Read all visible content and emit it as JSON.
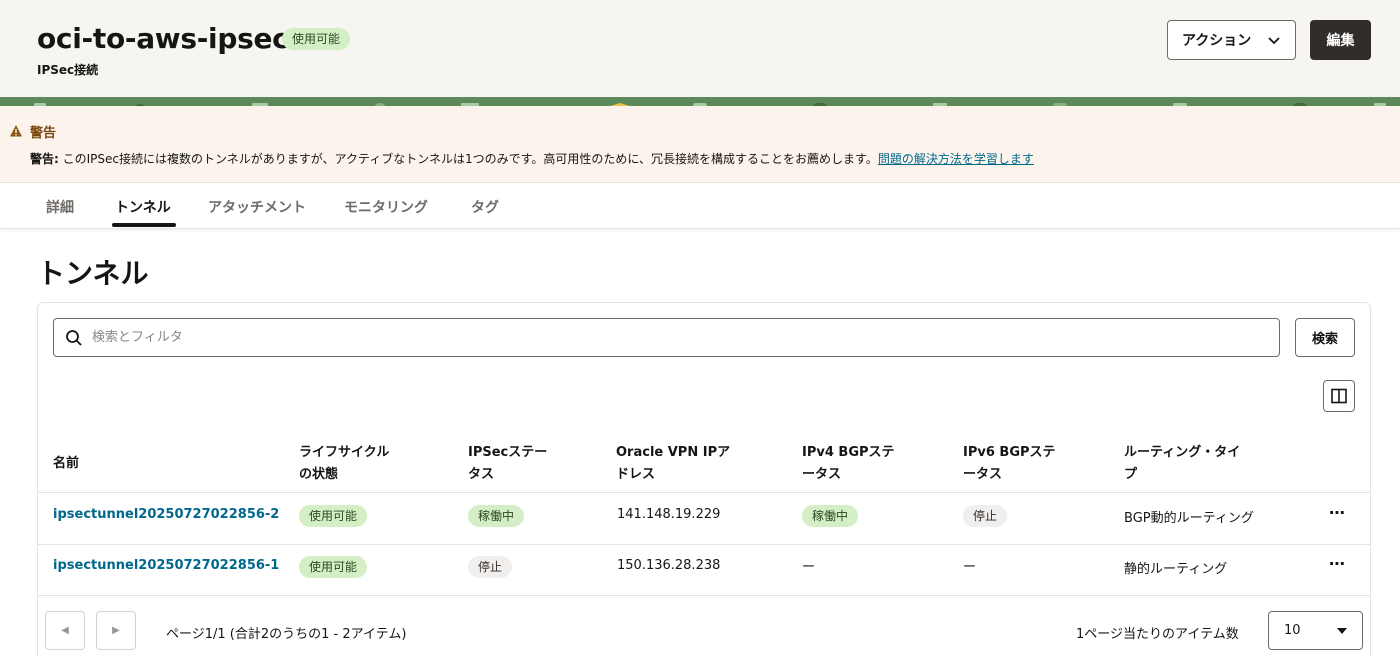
{
  "header": {
    "title": "oci-to-aws-ipsec",
    "status_badge": "使用可能",
    "subtitle": "IPSec接続",
    "action_label": "アクション",
    "edit_label": "編集"
  },
  "warning": {
    "title": "警告",
    "prefix": "警告:",
    "message": " このIPSec接続には複数のトンネルがありますが、アクティブなトンネルは1つのみです。高可用性のために、冗長接続を構成することをお薦めします。",
    "link": "問題の解決方法を学習します"
  },
  "tabs": [
    {
      "label": "詳細"
    },
    {
      "label": "トンネル",
      "active": true
    },
    {
      "label": "アタッチメント"
    },
    {
      "label": "モニタリング"
    },
    {
      "label": "タグ"
    }
  ],
  "section": {
    "title": "トンネル"
  },
  "search": {
    "placeholder": "検索とフィルタ",
    "button": "検索"
  },
  "table": {
    "headers": [
      {
        "line1": "名前",
        "line2": ""
      },
      {
        "line1": "ライフサイクル",
        "line2": "の状態"
      },
      {
        "line1": "IPSecステー",
        "line2": "タス"
      },
      {
        "line1": "Oracle VPN IPア",
        "line2": "ドレス"
      },
      {
        "line1": "IPv4 BGPステ",
        "line2": "ータス"
      },
      {
        "line1": "IPv6 BGPステ",
        "line2": "ータス"
      },
      {
        "line1": "ルーティング・タイ",
        "line2": "プ"
      }
    ],
    "rows": [
      {
        "name": "ipsectunnel20250727022856-2",
        "lifecycle": "使用可能",
        "ipsec_status": "稼働中",
        "vpn_ip": "141.148.19.229",
        "ipv4_bgp": "稼働中",
        "ipv6_bgp": "停止",
        "routing": "BGP動的ルーティング"
      },
      {
        "name": "ipsectunnel20250727022856-1",
        "lifecycle": "使用可能",
        "ipsec_status": "停止",
        "vpn_ip": "150.136.28.238",
        "ipv4_bgp": "ー",
        "ipv6_bgp": "ー",
        "routing": "静的ルーティング"
      }
    ]
  },
  "pagination": {
    "summary": "ページ1/1 (合計2のうちの1 - 2アイテム)",
    "per_page_label": "1ページ当たりのアイテム数",
    "per_page_value": "10"
  },
  "colors": {
    "link": "#00688c",
    "badge_green": "#d4eec6",
    "badge_gray": "#f1efed",
    "warning_bg": "#fcf4ec",
    "header_bg": "#f7f5f2",
    "primary_button": "#312d2a"
  }
}
